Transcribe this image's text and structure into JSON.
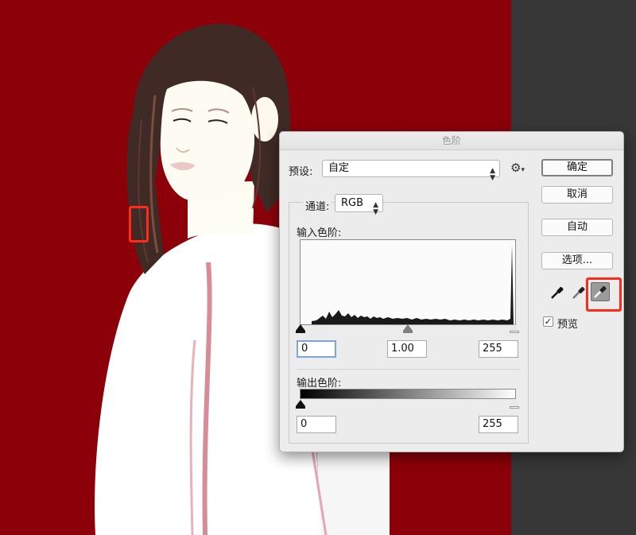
{
  "dialog": {
    "title": "色阶",
    "preset_label": "预设:",
    "preset_value": "自定",
    "channel_label": "通道:",
    "channel_value": "RGB",
    "input_levels_label": "输入色阶:",
    "output_levels_label": "输出色阶:",
    "input_black": "0",
    "input_gamma": "1.00",
    "input_white": "255",
    "output_black": "0",
    "output_white": "255",
    "buttons": {
      "ok": "确定",
      "cancel": "取消",
      "auto": "自动",
      "options": "选项..."
    },
    "preview_label": "预览",
    "preview_checked": true,
    "gear_icon": "gear-icon",
    "eyedroppers": [
      "black-point-eyedropper-icon",
      "gray-point-eyedropper-icon",
      "white-point-eyedropper-icon"
    ],
    "active_eyedropper": "white-point-eyedropper-icon"
  },
  "colors": {
    "canvas_background": "#8c0009",
    "side_panel": "#373737",
    "highlight": "#ff2a1a"
  }
}
